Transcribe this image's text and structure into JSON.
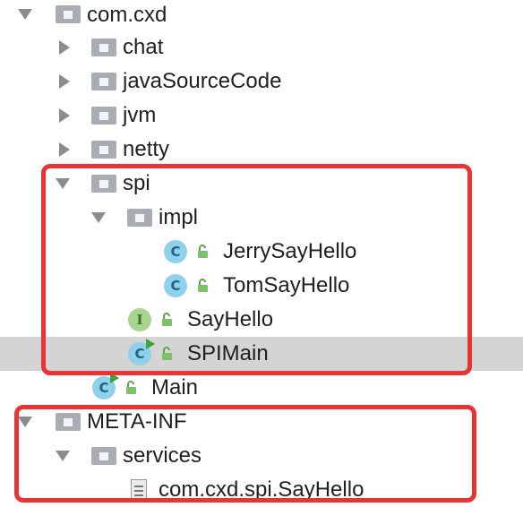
{
  "tree": {
    "root": {
      "label": "com.cxd"
    },
    "packages": [
      {
        "label": "chat"
      },
      {
        "label": "javaSourceCode"
      },
      {
        "label": "jvm"
      },
      {
        "label": "netty"
      },
      {
        "label": "spi"
      }
    ],
    "spi": {
      "impl": {
        "label": "impl"
      },
      "classes": [
        {
          "label": "JerrySayHello",
          "icon": "class-icon"
        },
        {
          "label": "TomSayHello",
          "icon": "class-icon"
        }
      ],
      "interface": {
        "label": "SayHello",
        "icon": "interface-icon",
        "badge": "I"
      },
      "main": {
        "label": "SPIMain",
        "icon": "class-run-icon"
      }
    },
    "main": {
      "label": "Main",
      "icon": "class-run-icon"
    },
    "meta_inf": {
      "label": "META-INF"
    },
    "services": {
      "label": "services"
    },
    "service_file": {
      "label": "com.cxd.spi.SayHello"
    },
    "class_badge": "C"
  },
  "colors": {
    "highlight": "#ea3335",
    "selected_row": "#d4d4d4",
    "class_icon": "#8fd0ea",
    "interface_icon": "#a7d58f",
    "folder": "#a9adb2",
    "run_badge": "#3aa33a"
  }
}
